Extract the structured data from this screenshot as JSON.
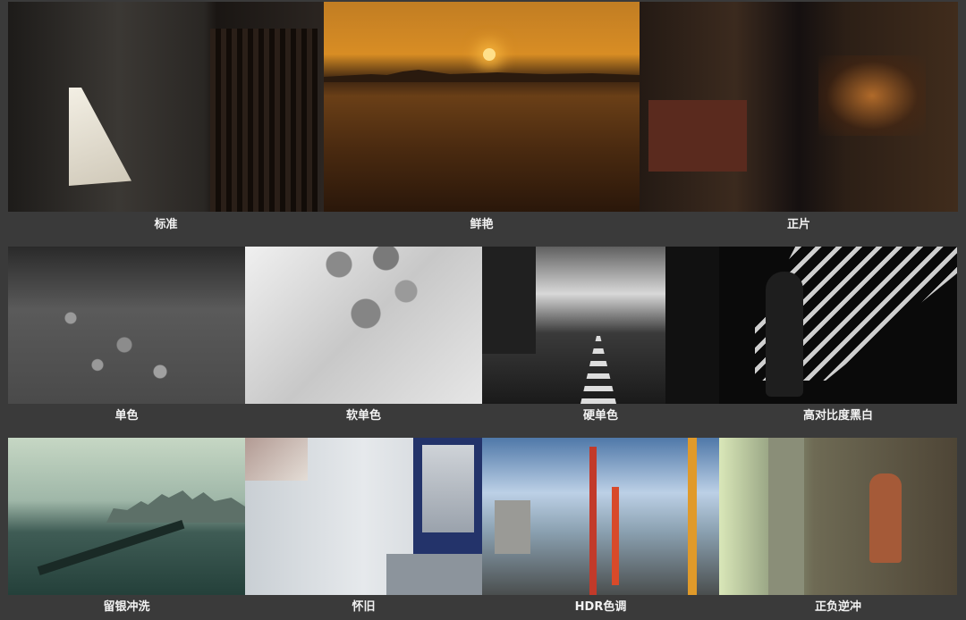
{
  "rows": [
    {
      "items": [
        {
          "id": "standard",
          "label": "标准"
        },
        {
          "id": "vivid",
          "label": "鲜艳"
        },
        {
          "id": "positive",
          "label": "正片"
        }
      ]
    },
    {
      "items": [
        {
          "id": "mono",
          "label": "单色"
        },
        {
          "id": "soft-mono",
          "label": "软单色"
        },
        {
          "id": "hard-mono",
          "label": "硬单色"
        },
        {
          "id": "high-contrast-bw",
          "label": "高对比度黑白"
        }
      ]
    },
    {
      "items": [
        {
          "id": "bleach-bypass",
          "label": "留银冲洗"
        },
        {
          "id": "retro",
          "label": "怀旧"
        },
        {
          "id": "hdr-tone",
          "label": "HDR色调"
        },
        {
          "id": "cross-process",
          "label": "正负逆冲"
        }
      ]
    }
  ],
  "colors": {
    "background": "#3a3a3a",
    "caption_text": "#f2f2f2"
  }
}
